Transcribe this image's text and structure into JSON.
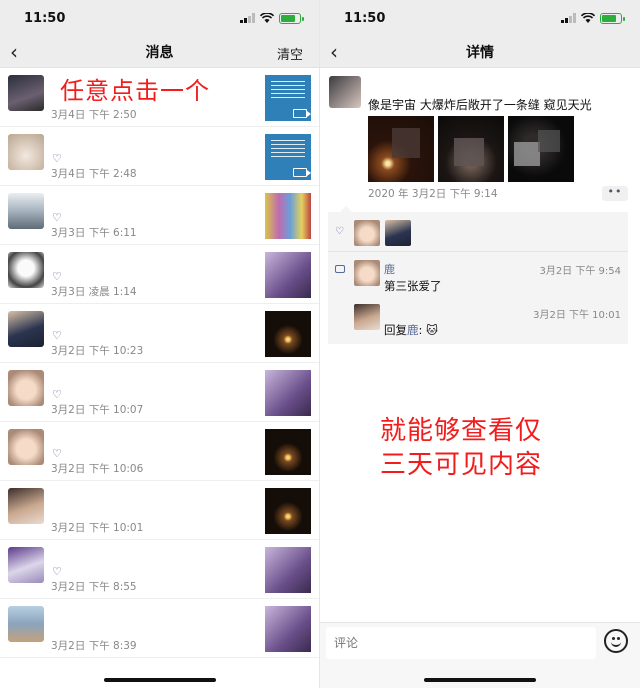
{
  "left_screen": {
    "status_time": "11:50",
    "nav_title": "消息",
    "clear_label": "清空",
    "overlay_text": "任意点击一个",
    "rows": [
      {
        "time": "3月4日 下午 2:50",
        "liked": false
      },
      {
        "time": "3月4日 下午 2:48",
        "liked": true
      },
      {
        "time": "3月3日 下午 6:11",
        "liked": true
      },
      {
        "time": "3月3日 凌晨 1:14",
        "liked": true
      },
      {
        "time": "3月2日 下午 10:23",
        "liked": true
      },
      {
        "time": "3月2日 下午 10:07",
        "liked": true
      },
      {
        "time": "3月2日 下午 10:06",
        "liked": true
      },
      {
        "time": "3月2日 下午 10:01",
        "liked": false
      },
      {
        "time": "3月2日 下午 8:55",
        "liked": true
      },
      {
        "time": "3月2日 下午 8:39",
        "liked": false
      }
    ]
  },
  "right_screen": {
    "status_time": "11:50",
    "nav_title": "详情",
    "post": {
      "text": "像是宇宙 大爆炸后敞开了一条缝 窥见天光",
      "date": "2020 年 3月2日 下午 9:14",
      "more": "••"
    },
    "comments": [
      {
        "name": "鹿",
        "time": "3月2日 下午 9:54",
        "text": "第三张爱了"
      },
      {
        "time": "3月2日 下午 10:01",
        "reply_prefix": "回复",
        "reply_to": "鹿",
        "reply_suffix": ": 🐱"
      }
    ],
    "overlay_line1": "就能够查看仅",
    "overlay_line2": "三天可见内容",
    "input_placeholder": "评论"
  },
  "colors": {
    "overlay": "#f21c1c",
    "link": "#576b95",
    "nav_bg": "#ededed",
    "battery": "#2cae3c"
  }
}
